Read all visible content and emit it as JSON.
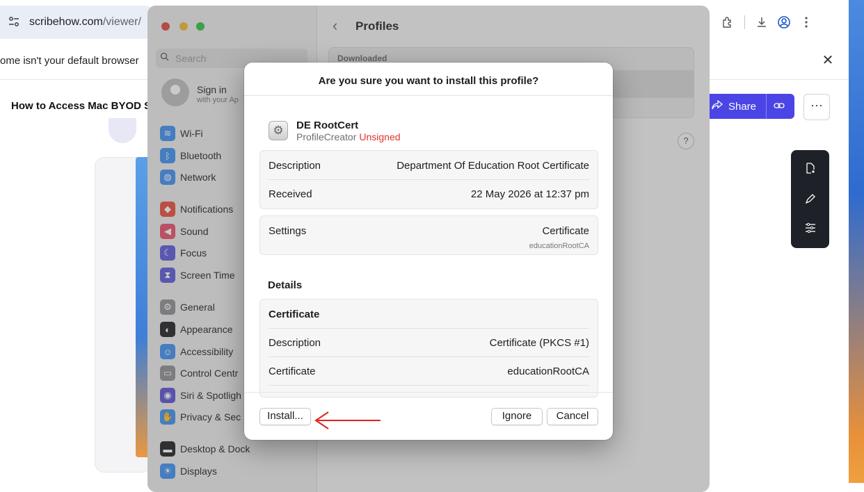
{
  "browser": {
    "url_host": "scribehow.com",
    "url_path": "/viewer/",
    "infobar_text": "ome isn't your default browser",
    "page_title": "How to Access Mac BYOD S",
    "share_label": "Share",
    "more_label": "···"
  },
  "system_settings": {
    "search_placeholder": "Search",
    "signin_title": "Sign in",
    "signin_sub": "with your Ap",
    "pane_title": "Profiles",
    "list_header": "Downloaded",
    "help_label": "?",
    "sidebar": [
      {
        "label": "Wi-Fi",
        "icon": "wifi-icon",
        "color": "#3b8ef0"
      },
      {
        "label": "Bluetooth",
        "icon": "bluetooth-icon",
        "color": "#3b8ef0"
      },
      {
        "label": "Network",
        "icon": "globe-icon",
        "color": "#3b8ef0"
      },
      {
        "label": "Notifications",
        "icon": "bell-icon",
        "color": "#e94b3c"
      },
      {
        "label": "Sound",
        "icon": "speaker-icon",
        "color": "#e94b6a"
      },
      {
        "label": "Focus",
        "icon": "moon-icon",
        "color": "#5b58d6"
      },
      {
        "label": "Screen Time",
        "icon": "hourglass-icon",
        "color": "#5b58d6"
      },
      {
        "label": "General",
        "icon": "gear-icon",
        "color": "#8e8e93"
      },
      {
        "label": "Appearance",
        "icon": "appearance-icon",
        "color": "#1d1d1f"
      },
      {
        "label": "Accessibility",
        "icon": "accessibility-icon",
        "color": "#3b8ef0"
      },
      {
        "label": "Control Centr",
        "icon": "switches-icon",
        "color": "#8e8e93"
      },
      {
        "label": "Siri & Spotligh",
        "icon": "siri-icon",
        "color": "#5a4fd0"
      },
      {
        "label": "Privacy & Sec",
        "icon": "hand-icon",
        "color": "#3b8ef0"
      },
      {
        "label": "Desktop & Dock",
        "icon": "dock-icon",
        "color": "#1d1d1f"
      },
      {
        "label": "Displays",
        "icon": "sun-icon",
        "color": "#3b8ef0"
      }
    ]
  },
  "dialog": {
    "title": "Are you sure you want to install this profile?",
    "profile_name": "DE RootCert",
    "profile_source": "ProfileCreator",
    "profile_status": "Unsigned",
    "info_rows": [
      {
        "key": "Description",
        "value": "Department Of Education Root Certificate"
      },
      {
        "key": "Received",
        "value": "22 May 2026 at 12:37 pm"
      }
    ],
    "settings_key": "Settings",
    "settings_value": "Certificate",
    "settings_value_sub": "educationRootCA",
    "details_heading": "Details",
    "details_section": "Certificate",
    "details_rows": [
      {
        "key": "Description",
        "value": "Certificate (PKCS #1)"
      },
      {
        "key": "Certificate",
        "value": "educationRootCA"
      }
    ],
    "install_label": "Install...",
    "ignore_label": "Ignore",
    "cancel_label": "Cancel"
  },
  "colors": {
    "accent": "#4b45e6",
    "unsigned": "#e0342b",
    "annotation_arrow": "#e02020"
  }
}
